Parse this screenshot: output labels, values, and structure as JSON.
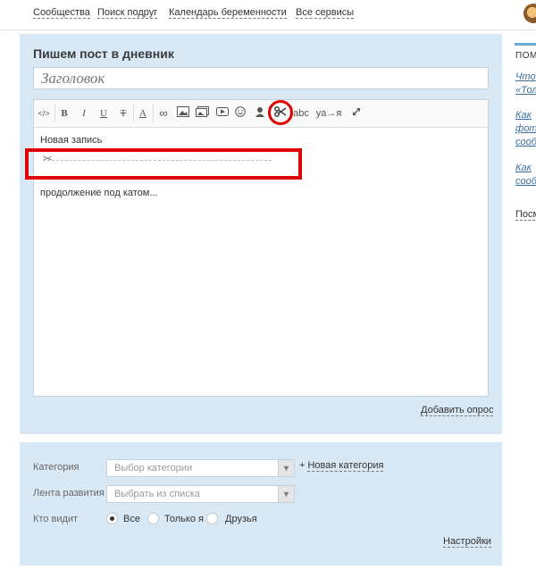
{
  "topnav": {
    "links": [
      "Сообщества",
      "Поиск подруг",
      "Календарь беременности",
      "Все сервисы"
    ]
  },
  "editor": {
    "heading": "Пишем пост в дневник",
    "title_placeholder": "Заголовок",
    "toolbar": {
      "code": "</>",
      "bold": "B",
      "italic": "I",
      "underline": "U",
      "strike": "T",
      "font_color": "A",
      "link": "∞",
      "spell": "abc",
      "translit": "ya→я"
    },
    "content_first_line": "Новая запись",
    "content_more": "продолжение под катом...",
    "add_poll": "Добавить опрос"
  },
  "settings_panel": {
    "category_label": "Категория",
    "category_placeholder": "Выбор категории",
    "new_category_label": "Новая категория",
    "feed_label": "Лента развития",
    "feed_placeholder": "Выбрать из списка",
    "visibility_label": "Кто видит",
    "visibility_options": [
      "Все",
      "Только я",
      "Друзья"
    ],
    "selected_visibility": "Все",
    "settings_link": "Настройки"
  },
  "sidebar": {
    "help": "ПОМО",
    "links": [
      "Что\n«Тол",
      "Как\nфот\nсооб",
      "Как\nсооб"
    ],
    "last": "Посм"
  },
  "colors": {
    "panel_bg": "#d8e9f5",
    "highlight_red": "#e00000"
  }
}
